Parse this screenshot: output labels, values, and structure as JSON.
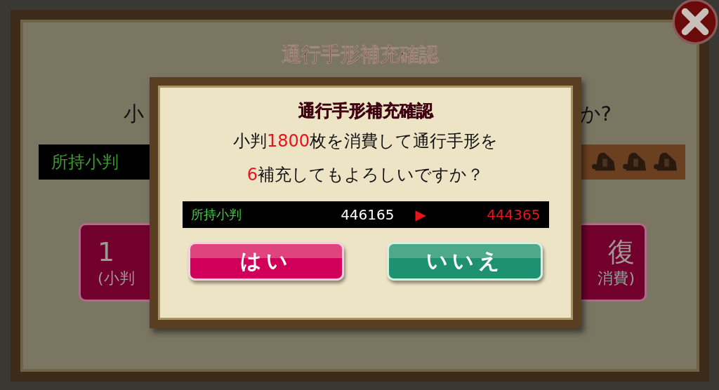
{
  "background_dialog": {
    "title": "通行手形補充確認",
    "message_start": "小",
    "message_end": "か?",
    "coin_label": "所持小判",
    "buttons": [
      {
        "main": "1",
        "sub": "(小判"
      },
      {
        "main": "復",
        "sub": "消費)"
      }
    ]
  },
  "dialog": {
    "title": "通行手形補充確認",
    "message_lines": [
      [
        {
          "text": "小判",
          "highlight": false
        },
        {
          "text": "1800",
          "highlight": true
        },
        {
          "text": "枚を消費して通行手形を",
          "highlight": false
        }
      ],
      [
        {
          "text": "6",
          "highlight": true
        },
        {
          "text": "補充してもよろしいですか？",
          "highlight": false
        }
      ]
    ],
    "coins": {
      "label": "所持小判",
      "current": "446165",
      "arrow": "▶",
      "after": "444365"
    },
    "buttons": [
      {
        "label": "はい",
        "kind": "confirm"
      },
      {
        "label": "いいえ",
        "kind": "cancel"
      }
    ]
  }
}
